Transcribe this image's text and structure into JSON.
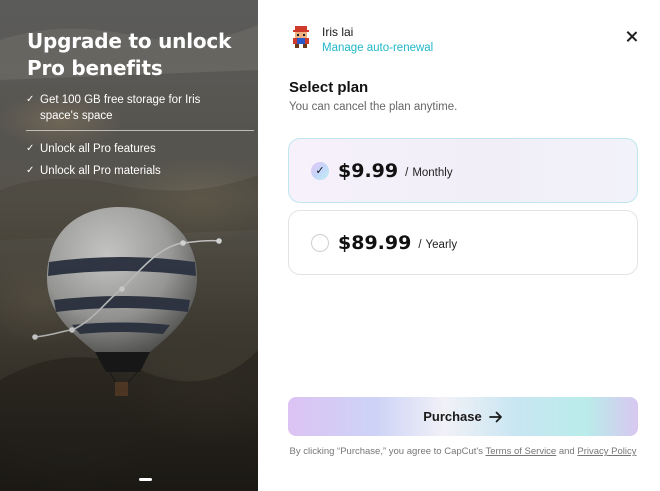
{
  "promo": {
    "headline": "Upgrade to unlock Pro benefits",
    "benefits": [
      "Get 100 GB free storage for Iris space's space",
      "Unlock all Pro features",
      "Unlock all Pro materials"
    ]
  },
  "account": {
    "name": "Iris lai",
    "manage_link": "Manage auto-renewal"
  },
  "plans": {
    "title": "Select plan",
    "subtitle": "You can cancel the plan anytime.",
    "options": [
      {
        "price": "$9.99",
        "separator": "/",
        "period": "Monthly",
        "selected": true
      },
      {
        "price": "$89.99",
        "separator": "/",
        "period": "Yearly",
        "selected": false
      }
    ]
  },
  "purchase": {
    "label": "Purchase"
  },
  "legal": {
    "prefix": "By clicking “Purchase,” you agree to CapCut's",
    "terms": "Terms of Service",
    "and": "and",
    "privacy": "Privacy Policy"
  },
  "icons": {
    "close": "close-icon",
    "check": "check-icon",
    "arrow": "arrow-right-icon",
    "avatar": "pixel-avatar"
  },
  "colors": {
    "link": "#20b8c8",
    "selected_border": "#bfe6ee"
  }
}
